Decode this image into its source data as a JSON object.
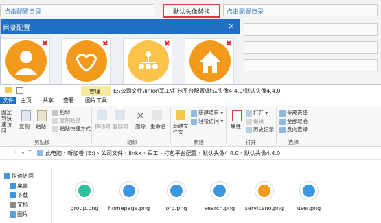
{
  "config_page": {
    "link_left": "点击配置目录",
    "highlight_label": "默认头像替换",
    "link_right": "点击配置目录"
  },
  "dialog": {
    "title": "目录配置",
    "close": "×",
    "tiles": [
      {
        "icon": "user-avatar-icon",
        "color": "#f39a1d",
        "delete": "✖"
      },
      {
        "icon": "handshake-icon",
        "color": "#f39a1d",
        "delete": "✖"
      },
      {
        "icon": "org-chart-icon",
        "color": "#fbc34a",
        "delete": "✖"
      },
      {
        "icon": "home-icon",
        "color": "#f39a1d",
        "delete": "✖"
      }
    ]
  },
  "explorer": {
    "window_title": "E:\\公司文件\\linkx\\军工\\打包平台配置\\默认头像4.4.0\\默认头像4.4.0",
    "context_tab": "管理",
    "tabs": [
      "文件",
      "主页",
      "共享",
      "查看",
      "图片工具"
    ],
    "ribbon": {
      "pin": "固定到快速访问",
      "copy": "复制",
      "paste": "粘贴",
      "cut": "剪切",
      "copy_path": "复制路径",
      "paste_shortcut": "粘贴快捷方式",
      "group_clipboard": "剪贴板",
      "move_to": "移动到",
      "copy_to": "复制到",
      "delete": "删除",
      "rename": "重命名",
      "group_organize": "组织",
      "new_folder": "新建文件夹",
      "new_item": "新建项目 ▾",
      "easy_access": "轻松访问 ▾",
      "group_new": "新建",
      "properties": "属性",
      "open": "打开 ▾",
      "edit": "编辑",
      "history": "历史记录",
      "group_open": "打开",
      "select_all": "全部选择",
      "select_none": "全部取消",
      "invert": "反向选择",
      "group_select": "选择"
    },
    "breadcrumb": "此电脑 › 新加卷 (E:) › 公司文件 › linkx › 军工 › 打包平台配置 › 默认头像4.4.0 › 默认头像4.4.0",
    "nav": [
      "快速访问",
      "桌面",
      "下载",
      "文档",
      "图片"
    ],
    "files": [
      {
        "name": "group.png",
        "color": "#2fbfa0",
        "icon": "group-icon"
      },
      {
        "name": "homepage.png",
        "color": "#3b97e0",
        "icon": "home-icon"
      },
      {
        "name": "org.png",
        "color": "#3b97e0",
        "icon": "org-chart-icon"
      },
      {
        "name": "search.png",
        "color": "#3b97e0",
        "icon": "search-icon"
      },
      {
        "name": "serviceno.png",
        "color": "#f39a1d",
        "icon": "service-icon"
      },
      {
        "name": "user.png",
        "color": "#3b97e0",
        "icon": "user-icon"
      }
    ]
  }
}
